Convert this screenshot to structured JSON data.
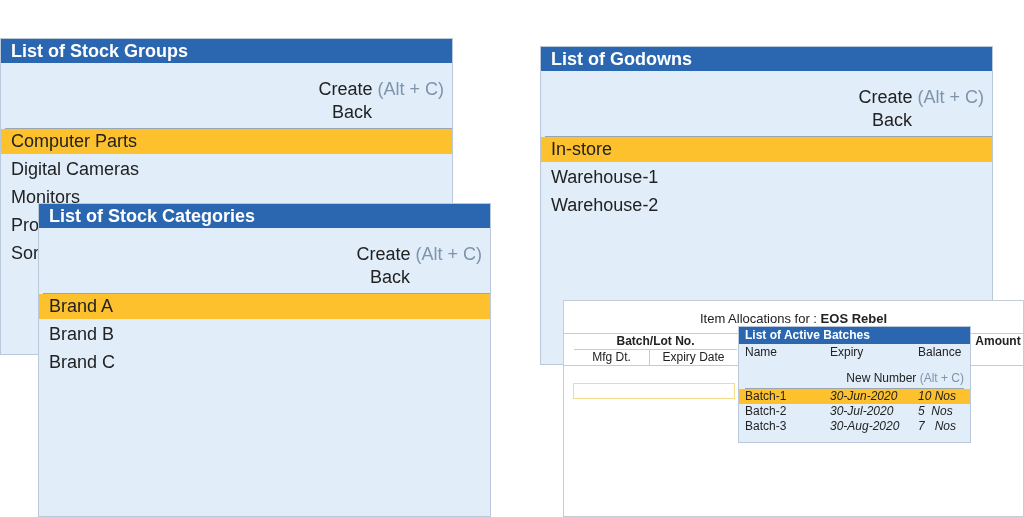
{
  "list_windows": [
    {
      "title": "List of Stock Groups",
      "create_label": "Create",
      "create_shortcut": "(Alt + C)",
      "back_label": "Back",
      "items": [
        {
          "label": "Computer Parts",
          "selected": true
        },
        {
          "label": "Digital Cameras",
          "selected": false
        },
        {
          "label": "Monitors",
          "selected": false
        },
        {
          "label": "Pro",
          "selected": false
        },
        {
          "label": "Sor",
          "selected": false
        }
      ]
    },
    {
      "title": "List of Godowns",
      "create_label": "Create",
      "create_shortcut": "(Alt + C)",
      "back_label": "Back",
      "items": [
        {
          "label": "In-store",
          "selected": true
        },
        {
          "label": "Warehouse-1",
          "selected": false
        },
        {
          "label": "Warehouse-2",
          "selected": false
        }
      ]
    },
    {
      "title": "List of Stock Categories",
      "create_label": "Create",
      "create_shortcut": "(Alt + C)",
      "back_label": "Back",
      "items": [
        {
          "label": "Brand A",
          "selected": true
        },
        {
          "label": "Brand B",
          "selected": false
        },
        {
          "label": "Brand C",
          "selected": false
        }
      ]
    }
  ],
  "item_allocations": {
    "heading": "Item Allocations for :",
    "item": "EOS Rebel",
    "group_column": "Batch/Lot No.",
    "columns": [
      "Mfg Dt.",
      "Expiry Date"
    ],
    "last_column": "Amount"
  },
  "active_batches": {
    "title": "List of Active Batches",
    "columns": [
      "Name",
      "Expiry",
      "Balance"
    ],
    "new_label": "New Number",
    "new_shortcut": "(Alt + C)",
    "rows": [
      {
        "name": "Batch-1",
        "expiry": "30-Jun-2020",
        "balance": "10 Nos",
        "selected": true
      },
      {
        "name": "Batch-2",
        "expiry": "30-Jul-2020",
        "balance": "5  Nos",
        "selected": false
      },
      {
        "name": "Batch-3",
        "expiry": "30-Aug-2020",
        "balance": "7   Nos",
        "selected": false
      }
    ]
  }
}
